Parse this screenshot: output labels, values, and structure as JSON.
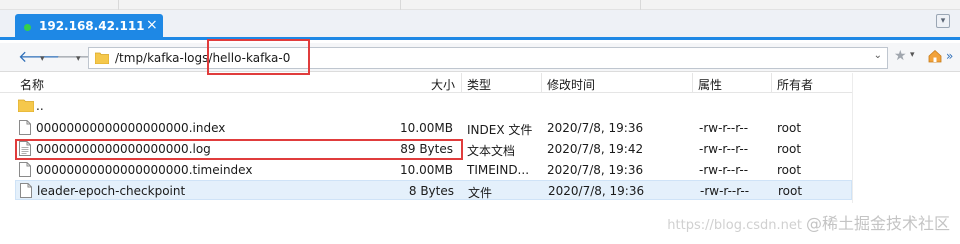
{
  "tab": {
    "title": "192.168.42.111",
    "close": "×",
    "status_color": "#35d04a",
    "accent": "#1e88e5"
  },
  "address": {
    "path_prefix": "/tmp/kafka-logs/",
    "path_suffix": "hello-kafka-0"
  },
  "icons": {
    "back": "back-arrow-icon",
    "forward": "forward-arrow-icon",
    "folder": "folder-icon",
    "star": "star-icon",
    "home": "home-icon"
  },
  "columns": [
    "名称",
    "大小",
    "类型",
    "修改时间",
    "属性",
    "所有者"
  ],
  "rows": [
    {
      "name": "..",
      "size": "",
      "type": "",
      "modified": "",
      "perm": "",
      "owner": "",
      "icon": "folder"
    },
    {
      "name": "00000000000000000000.index",
      "size": "10.00MB",
      "type": "INDEX 文件",
      "modified": "2020/7/8, 19:36",
      "perm": "-rw-r--r--",
      "owner": "root",
      "icon": "file"
    },
    {
      "name": "00000000000000000000.log",
      "size": "89 Bytes",
      "type": "文本文档",
      "modified": "2020/7/8, 19:42",
      "perm": "-rw-r--r--",
      "owner": "root",
      "icon": "text"
    },
    {
      "name": "00000000000000000000.timeindex",
      "size": "10.00MB",
      "type": "TIMEIND...",
      "modified": "2020/7/8, 19:36",
      "perm": "-rw-r--r--",
      "owner": "root",
      "icon": "file"
    },
    {
      "name": "leader-epoch-checkpoint",
      "size": "8 Bytes",
      "type": "文件",
      "modified": "2020/7/8, 19:36",
      "perm": "-rw-r--r--",
      "owner": "root",
      "icon": "file"
    }
  ],
  "highlight_color": "#e03c3c",
  "watermark": {
    "sub": "https://blog.csdn.net",
    "main": "@稀土掘金技术社区"
  }
}
